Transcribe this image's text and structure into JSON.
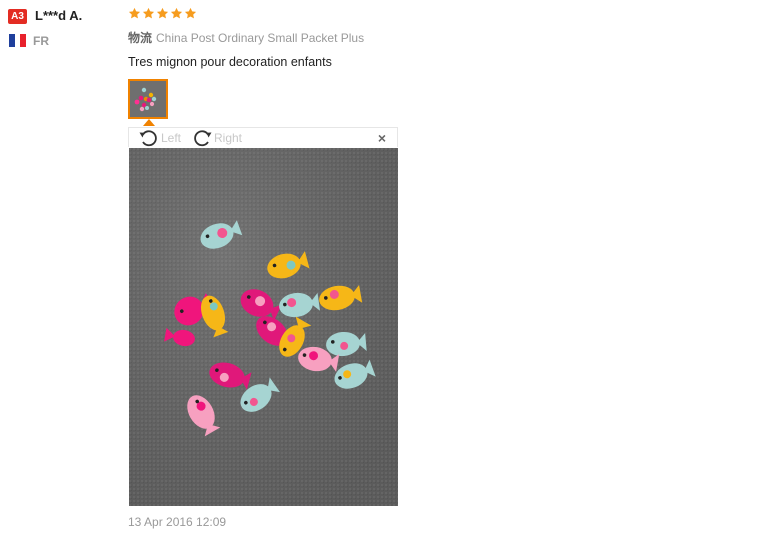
{
  "review": {
    "user": {
      "level": "A3",
      "name": "L***d A.",
      "country": "FR",
      "flag_colors": [
        "#1f3f9c",
        "#ffffff",
        "#e8212c"
      ]
    },
    "rating": 5,
    "logistics": {
      "label": "物流",
      "value": "China Post Ordinary Small Packet Plus"
    },
    "text": "Tres mignon pour decoration enfants",
    "viewer": {
      "rotate_left": "Left",
      "rotate_right": "Right",
      "close": "×"
    },
    "date": "13 Apr 2016 12:09"
  },
  "colors": {
    "star": "#f69c1e",
    "accent": "#f08200",
    "badge": "#e32c23"
  },
  "icons": [
    "star-icon",
    "rotate-left-icon",
    "rotate-right-icon",
    "close-icon"
  ]
}
